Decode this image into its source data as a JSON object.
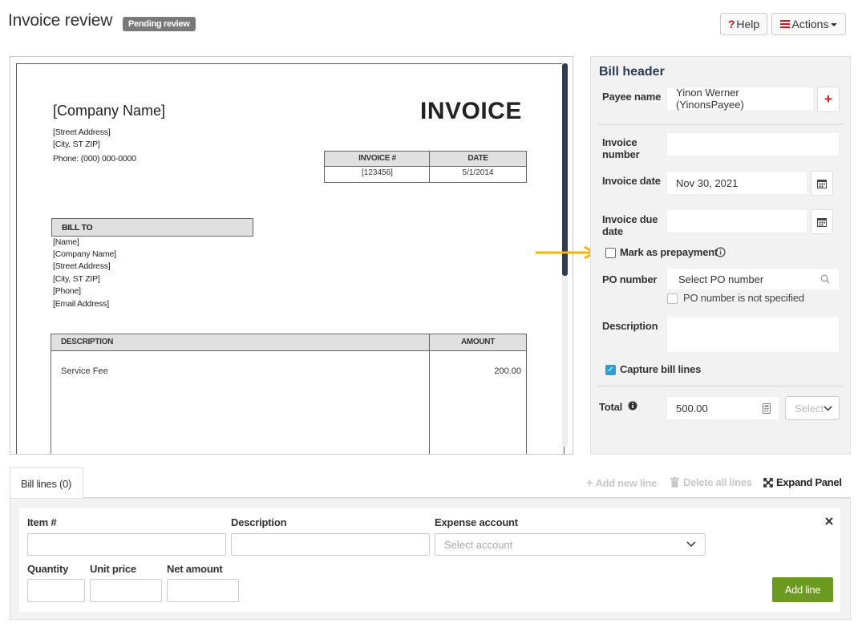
{
  "header": {
    "title": "Invoice review",
    "status_badge": "Pending review",
    "help_label": "Help",
    "help_glyph": "?",
    "actions_label": "Actions"
  },
  "document": {
    "company_name": "[Company Name]",
    "invoice_word": "INVOICE",
    "address_lines": [
      "[Street Address]",
      "[City, ST  ZIP]",
      "Phone: (000) 000-0000"
    ],
    "meta_headers": [
      "INVOICE #",
      "DATE"
    ],
    "meta_values": [
      "[123456]",
      "5/1/2014"
    ],
    "bill_to_label": "BILL TO",
    "bill_to_lines": [
      "[Name]",
      "[Company Name]",
      "[Street Address]",
      "[City, ST  ZIP]",
      "[Phone]",
      "[Email Address]"
    ],
    "line_headers": [
      "DESCRIPTION",
      "AMOUNT"
    ],
    "line_items": [
      {
        "description": "Service Fee",
        "amount": "200.00"
      }
    ]
  },
  "bill_header": {
    "title": "Bill header",
    "payee_label": "Payee name",
    "payee_value": "Yinon Werner (YinonsPayee)",
    "invoice_number_label": "Invoice number",
    "invoice_number_value": "",
    "invoice_date_label": "Invoice date",
    "invoice_date_value": "Nov 30, 2021",
    "due_date_label": "Invoice due date",
    "due_date_value": "",
    "prepayment_label": "Mark as prepayment",
    "prepayment_checked": false,
    "po_label": "PO number",
    "po_placeholder": "Select PO number",
    "po_not_specified_label": "PO number is not specified",
    "description_label": "Description",
    "description_value": "",
    "capture_lines_label": "Capture bill lines",
    "capture_lines_checked": true,
    "total_label": "Total",
    "total_value": "500.00",
    "currency_placeholder": "Select"
  },
  "bill_lines": {
    "tab_label": "Bill lines (0)",
    "add_new_line_label": "Add new line",
    "delete_all_label": "Delete all lines",
    "expand_label": "Expand Panel",
    "item_label": "Item #",
    "description_label": "Description",
    "expense_account_label": "Expense account",
    "expense_account_placeholder": "Select account",
    "quantity_label": "Quantity",
    "unit_price_label": "Unit price",
    "net_amount_label": "Net amount",
    "add_line_label": "Add line"
  },
  "colors": {
    "arrow": "#f4b400",
    "add_line_button": "#6b9a1f",
    "checkbox_checked": "#2a9fd8",
    "help_red": "#dd1111"
  }
}
